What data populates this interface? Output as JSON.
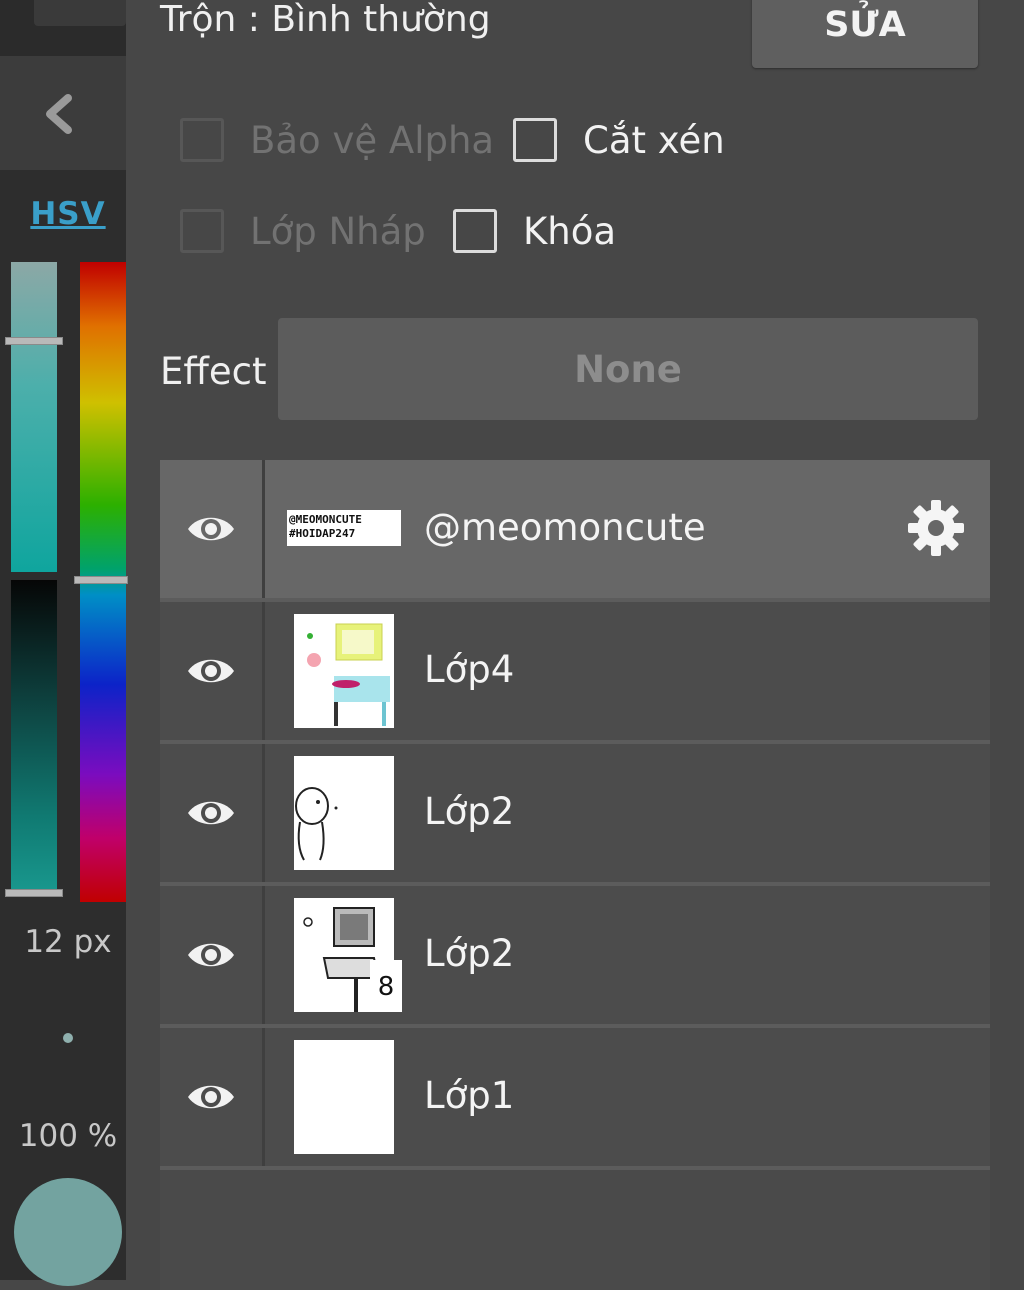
{
  "header": {
    "blend_mode": "Trộn : Bình thường",
    "edit_button": "SỬA"
  },
  "options": {
    "alpha_protect": "Bảo vệ Alpha",
    "clipping": "Cắt xén",
    "draft_layer": "Lớp Nháp",
    "lock": "Khóa"
  },
  "effect": {
    "label": "Effect",
    "value": "None"
  },
  "toolbar": {
    "color_mode": "HSV",
    "brush_size": "12 px",
    "opacity": "100 %",
    "current_color": "#73a3a0"
  },
  "layers": [
    {
      "name": "@meomoncute",
      "visible": true,
      "selected": true,
      "watermark_text": "@MEOMONCUTE\n#HOIDAP247"
    },
    {
      "name": "Lớp4",
      "visible": true,
      "selected": false
    },
    {
      "name": "Lớp2",
      "visible": true,
      "selected": false
    },
    {
      "name": "Lớp2",
      "visible": true,
      "selected": false,
      "badge": "8"
    },
    {
      "name": "Lớp1",
      "visible": true,
      "selected": false
    }
  ],
  "colors": {
    "background": "#474747",
    "sidebar": "#2d2d2d",
    "accent_link": "#3a9fc9",
    "selected_row": "#676767"
  }
}
